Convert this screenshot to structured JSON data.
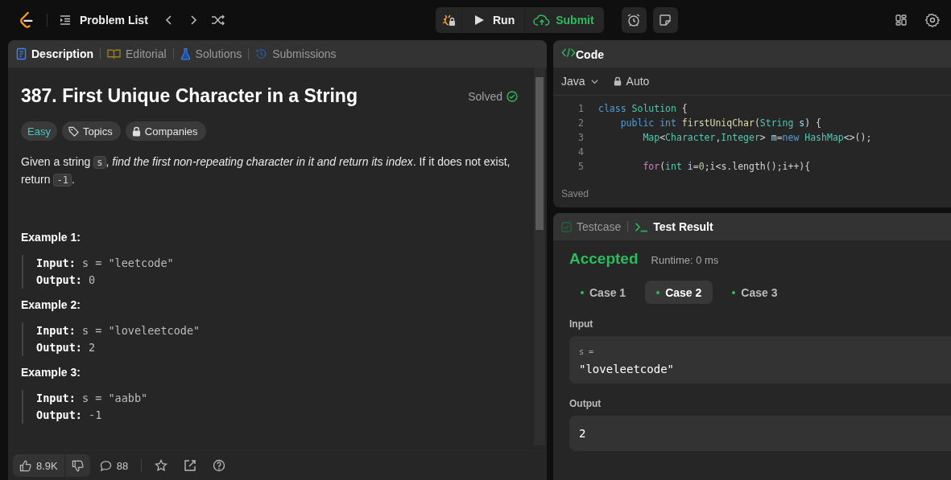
{
  "top_bar": {
    "nav_label": "Problem List",
    "run_label": "Run",
    "submit_label": "Submit"
  },
  "description_panel": {
    "tabs": [
      {
        "label": "Description",
        "kind": "description",
        "selected": true
      },
      {
        "label": "Editorial",
        "kind": "editorial",
        "selected": false
      },
      {
        "label": "Solutions",
        "kind": "solutions",
        "selected": false
      },
      {
        "label": "Submissions",
        "kind": "submissions",
        "selected": false
      }
    ],
    "title": "387. First Unique Character in a String",
    "status": "Solved",
    "tags": [
      {
        "label": "Easy",
        "kind": "difficulty"
      },
      {
        "label": "Topics",
        "kind": "topics"
      },
      {
        "label": "Companies",
        "kind": "companies"
      }
    ],
    "statement": [
      {
        "text": "Given a string ",
        "kind": "plain"
      },
      {
        "text": "s",
        "kind": "code"
      },
      {
        "text": ", ",
        "kind": "plain"
      },
      {
        "text": "find the first non-repeating character in it and return its index",
        "kind": "italic"
      },
      {
        "text": ". If it does not exist, return ",
        "kind": "plain"
      },
      {
        "text": "-1",
        "kind": "code"
      },
      {
        "text": ".",
        "kind": "plain"
      }
    ],
    "examples": [
      {
        "title": "Example 1:",
        "lines": [
          {
            "label": "Input:",
            "value": "s = \"leetcode\""
          },
          {
            "label": "Output:",
            "value": "0"
          }
        ]
      },
      {
        "title": "Example 2:",
        "lines": [
          {
            "label": "Input:",
            "value": "s = \"loveleetcode\""
          },
          {
            "label": "Output:",
            "value": "2"
          }
        ]
      },
      {
        "title": "Example 3:",
        "lines": [
          {
            "label": "Input:",
            "value": "s = \"aabb\""
          },
          {
            "label": "Output:",
            "value": "-1"
          }
        ]
      }
    ],
    "footer": {
      "likes": "8.9K",
      "comments": "88"
    }
  },
  "code_panel": {
    "title": "Code",
    "language": "Java",
    "mode": "Auto",
    "status": "Saved",
    "lines": [
      {
        "number": "1",
        "tokens": [
          {
            "text": "class ",
            "kind": "keyword"
          },
          {
            "text": "Solution",
            "kind": "type"
          },
          {
            "text": " {",
            "kind": "plain"
          }
        ]
      },
      {
        "number": "2",
        "tokens": [
          {
            "text": "    public int ",
            "kind": "keyword"
          },
          {
            "text": "firstUniqChar",
            "kind": "method"
          },
          {
            "text": "(",
            "kind": "plain"
          },
          {
            "text": "String",
            "kind": "type"
          },
          {
            "text": " s",
            "kind": "variable"
          },
          {
            "text": ") {",
            "kind": "plain"
          }
        ]
      },
      {
        "number": "3",
        "tokens": [
          {
            "text": "        Map",
            "kind": "type"
          },
          {
            "text": "<",
            "kind": "plain"
          },
          {
            "text": "Character",
            "kind": "type"
          },
          {
            "text": ",",
            "kind": "plain"
          },
          {
            "text": "Integer",
            "kind": "type"
          },
          {
            "text": "> ",
            "kind": "plain"
          },
          {
            "text": "m",
            "kind": "variable"
          },
          {
            "text": "=",
            "kind": "plain"
          },
          {
            "text": "new ",
            "kind": "keyword"
          },
          {
            "text": "HashMap",
            "kind": "type"
          },
          {
            "text": "<>();",
            "kind": "plain"
          }
        ]
      },
      {
        "number": "4"
      },
      {
        "number": "5",
        "tokens": [
          {
            "text": "        for",
            "kind": "control"
          },
          {
            "text": "(",
            "kind": "plain"
          },
          {
            "text": "int ",
            "kind": "type"
          },
          {
            "text": "i",
            "kind": "variable"
          },
          {
            "text": "=",
            "kind": "plain"
          },
          {
            "text": "0",
            "kind": "number"
          },
          {
            "text": ";i<s.length();i++){",
            "kind": "plain"
          }
        ]
      }
    ]
  },
  "result_panel": {
    "tabs": [
      {
        "label": "Testcase",
        "kind": "testcase",
        "selected": false
      },
      {
        "label": "Test Result",
        "kind": "result",
        "selected": true
      }
    ],
    "verdict": "Accepted",
    "runtime": "Runtime: 0 ms",
    "cases": [
      {
        "label": "Case 1",
        "selected": false,
        "color": "#2cbb5d"
      },
      {
        "label": "Case 2",
        "selected": true,
        "color": "#2cbb5d"
      },
      {
        "label": "Case 3",
        "selected": false,
        "color": "#2cbb5d"
      }
    ],
    "input_label": "Input",
    "input_name": "s =",
    "input_value": "\"loveleetcode\"",
    "output_label": "Output",
    "output_value": "2"
  }
}
